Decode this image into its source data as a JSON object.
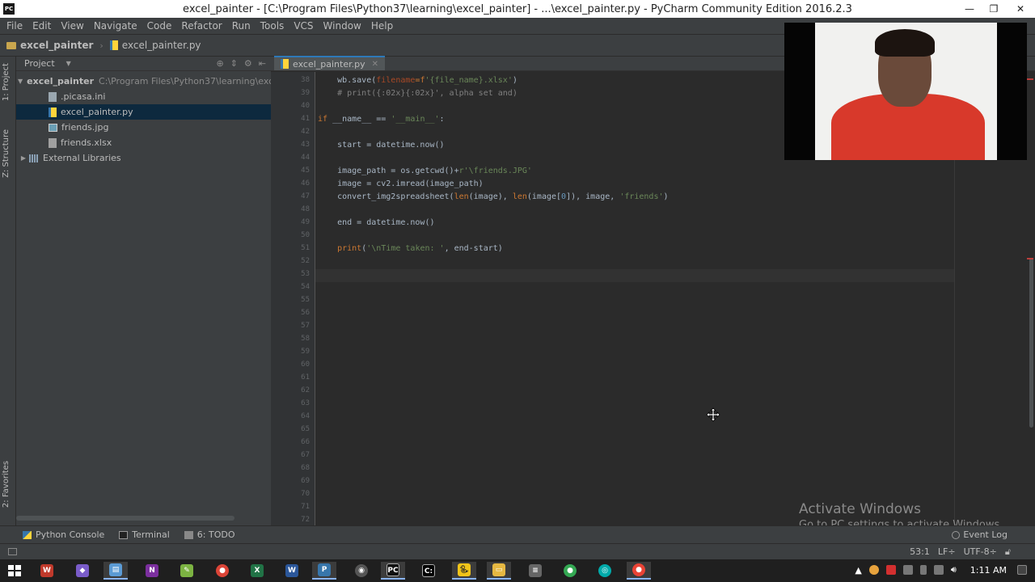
{
  "window": {
    "title": "excel_painter - [C:\\Program Files\\Python37\\learning\\excel_painter] - ...\\excel_painter.py - PyCharm Community Edition 2016.2.3",
    "minimize": "—",
    "restore": "❐",
    "close": "✕"
  },
  "menu": [
    "File",
    "Edit",
    "View",
    "Navigate",
    "Code",
    "Refactor",
    "Run",
    "Tools",
    "VCS",
    "Window",
    "Help"
  ],
  "navbar": {
    "project": "excel_painter",
    "file": "excel_painter.py"
  },
  "leftstrip": {
    "project_tab": "1: Project",
    "structure_tab": "Z: Structure",
    "favorites_tab": "2: Favorites"
  },
  "project_panel": {
    "header": "Project",
    "tree": [
      {
        "label": "excel_painter",
        "path": "C:\\Program Files\\Python37\\learning\\exc",
        "type": "folder"
      },
      {
        "label": ".picasa.ini",
        "type": "file"
      },
      {
        "label": "excel_painter.py",
        "type": "py"
      },
      {
        "label": "friends.jpg",
        "type": "img"
      },
      {
        "label": "friends.xlsx",
        "type": "xlsx"
      },
      {
        "label": "External Libraries",
        "type": "lib"
      }
    ]
  },
  "editor": {
    "tab": "excel_painter.py",
    "line_numbers": [
      "38",
      "39",
      "40",
      "41",
      "42",
      "43",
      "44",
      "45",
      "46",
      "47",
      "48",
      "49",
      "50",
      "51",
      "52",
      "53",
      "54",
      "55",
      "56",
      "57",
      "58",
      "59",
      "60",
      "61",
      "62",
      "63",
      "64",
      "65",
      "66",
      "67",
      "68",
      "69",
      "70",
      "71",
      "72",
      "73"
    ],
    "code": {
      "l38a": "    wb.save(",
      "l38b": "filename",
      "l38c": "=f",
      "l38d": "'{file_name}.xlsx'",
      "l38e": ")",
      "l39": "    # print({:02x}{:02x}', alpha set and)",
      "l41a": "if",
      "l41b": " __name__ == ",
      "l41c": "'__main__'",
      "l41d": ":",
      "l43": "    start = datetime.now()",
      "l45a": "    image_path = os.getcwd()+",
      "l45b": "r'\\friends.JPG'",
      "l46": "    image = cv2.imread(image_path)",
      "l47a": "    convert_img2spreadsheet(",
      "l47b": "len",
      "l47c": "(image), ",
      "l47d": "len",
      "l47e": "(image[",
      "l47f": "0",
      "l47g": "]), image, ",
      "l47h": "'friends'",
      "l47i": ")",
      "l49": "    end = datetime.now()",
      "l51a": "    ",
      "l51b": "print",
      "l51c": "(",
      "l51d": "'\\nTime taken: '",
      "l51e": ", end-start)"
    }
  },
  "watermark": {
    "line1": "Activate Windows",
    "line2": "Go to PC settings to activate Windows."
  },
  "bottom_tabs": [
    "Python Console",
    "Terminal",
    "6: TODO"
  ],
  "event_log": "Event Log",
  "status": {
    "position": "53:1",
    "line_sep": "LF÷",
    "encoding": "UTF-8÷"
  },
  "taskbar": {
    "clock": "1:11 AM"
  }
}
